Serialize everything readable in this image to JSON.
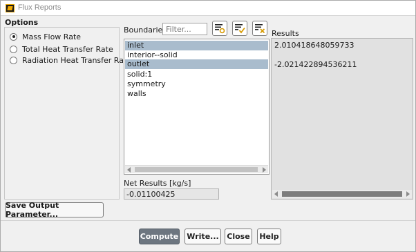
{
  "window": {
    "title": "Flux Reports"
  },
  "options": {
    "label": "Options",
    "radios": [
      {
        "label": "Mass Flow Rate",
        "checked": true
      },
      {
        "label": "Total Heat Transfer Rate",
        "checked": false
      },
      {
        "label": "Radiation Heat Transfer Rate",
        "checked": false
      }
    ]
  },
  "boundaries": {
    "label": "Boundaries",
    "filter_placeholder": "Filter...",
    "items": [
      {
        "label": "inlet",
        "selected": true
      },
      {
        "label": "interior--solid",
        "selected": false
      },
      {
        "label": "outlet",
        "selected": true
      },
      {
        "label": "solid:1",
        "selected": false
      },
      {
        "label": "symmetry",
        "selected": false
      },
      {
        "label": "walls",
        "selected": false
      }
    ]
  },
  "net_results": {
    "label": "Net Results [kg/s]",
    "value": "-0.01100425"
  },
  "results": {
    "label": "Results",
    "lines": [
      "2.010418648059733",
      "-2.021422894536211"
    ]
  },
  "buttons": {
    "save_output": "Save Output Parameter...",
    "compute": "Compute",
    "write": "Write...",
    "close": "Close",
    "help": "Help"
  },
  "colors": {
    "selection": "#a9bccd",
    "primary_button": "#6d7680"
  }
}
